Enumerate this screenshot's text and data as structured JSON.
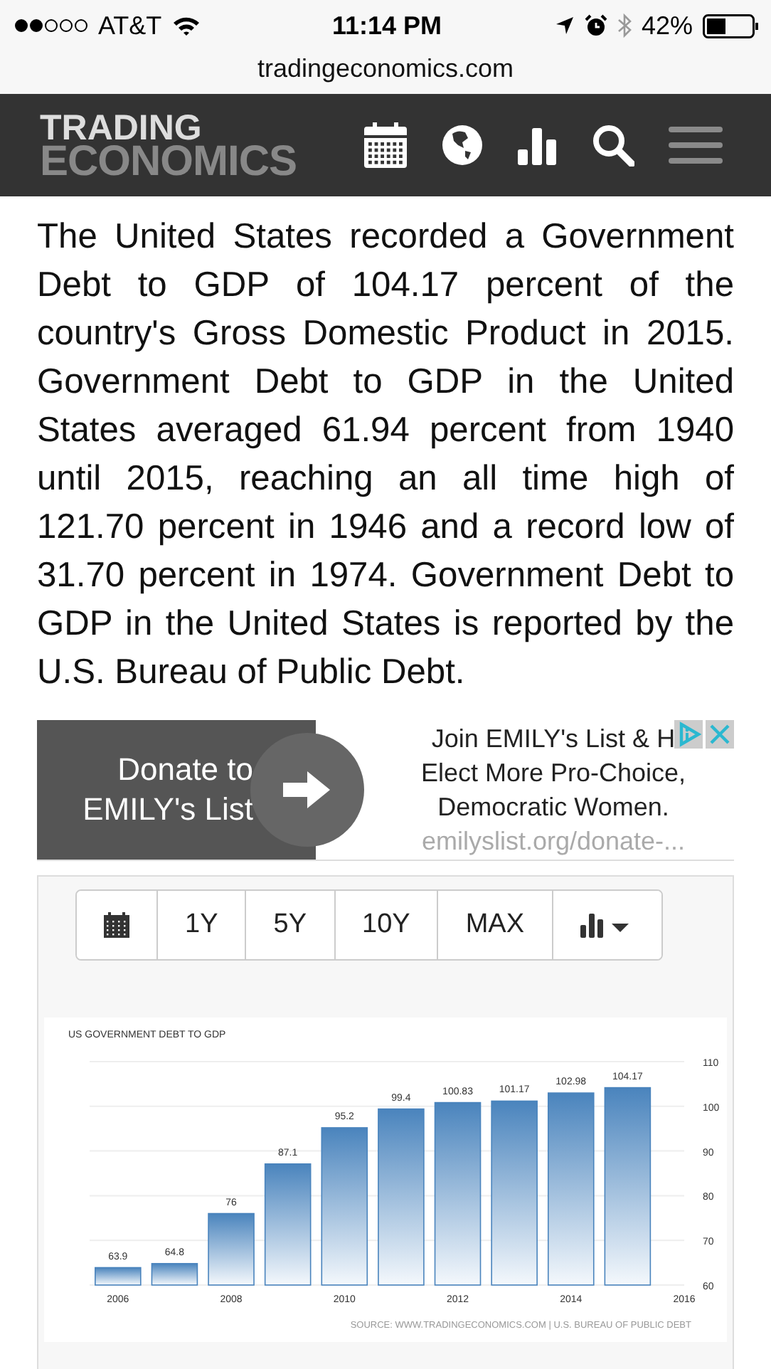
{
  "status_bar": {
    "carrier": "AT&T",
    "time": "11:14 PM",
    "battery": "42%",
    "url": "tradingeconomics.com"
  },
  "header": {
    "logo_top": "TRADING",
    "logo_bottom": "ECONOMICS"
  },
  "article": "The United States recorded a Government Debt to GDP of 104.17 percent of the country's Gross Domestic Product in 2015. Government Debt to GDP in the United States averaged 61.94 percent from 1940 until 2015, reaching an all time high of 121.70 percent in 1946 and a record low of 31.70 percent in 1974. Government Debt to GDP in the United States is reported by the U.S. Bureau of Public Debt.",
  "ad": {
    "button": "Donate to EMILY's List",
    "lines": [
      "Join EMILY's List & H",
      "Elect More Pro-Choice,",
      "Democratic Women."
    ],
    "url": "emilyslist.org/donate-..."
  },
  "toolbar": [
    {
      "kind": "calendar"
    },
    {
      "kind": "text",
      "label": "1Y"
    },
    {
      "kind": "text",
      "label": "5Y"
    },
    {
      "kind": "text",
      "label": "10Y"
    },
    {
      "kind": "text",
      "label": "MAX"
    },
    {
      "kind": "charttype"
    }
  ],
  "chart_data": {
    "type": "bar",
    "title": "US GOVERNMENT DEBT TO GDP",
    "x": [
      2006,
      2007,
      2008,
      2009,
      2010,
      2011,
      2012,
      2013,
      2014,
      2015
    ],
    "grid": true,
    "series": [
      {
        "color": "#4a84bd",
        "values": [
          63.9,
          64.8,
          76,
          87.1,
          95.2,
          99.4,
          100.83,
          101.17,
          102.98,
          104.17
        ]
      }
    ],
    "value_labels": [
      "63.9",
      "64.8",
      "76",
      "87.1",
      "95.2",
      "99.4",
      "100.83",
      "101.17",
      "102.98",
      "104.17"
    ],
    "xlim": [
      2005.5,
      2016
    ],
    "ylim": [
      60,
      110
    ],
    "xticks": [
      2006,
      2008,
      2010,
      2012,
      2014,
      2016
    ],
    "yticks": [
      60,
      70,
      80,
      90,
      100,
      110
    ],
    "data_labels": true,
    "annotations": [
      "SOURCE: WWW.TRADINGECONOMICS.COM | U.S. BUREAU OF PUBLIC DEBT"
    ]
  }
}
